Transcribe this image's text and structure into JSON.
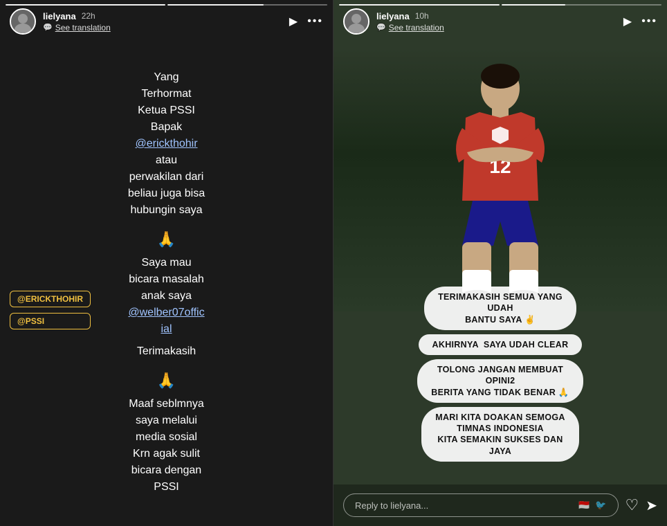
{
  "left_panel": {
    "username": "lielyana",
    "time_ago": "22h",
    "see_translation": "See translation",
    "play_label": "▶",
    "more_label": "•••",
    "content": {
      "paragraph1": "Yang\nTerhormat\nKetua PSSI\nBapak\n@erickthohir\natau\nperwakilan dari\nbeliau juga bisa\nhubungin saya",
      "prayer1": "🙏",
      "paragraph2": "Saya mau\nbicara masalah\nanak saya\n@welber07offic\nial",
      "paragraph3": "Terimakasih",
      "prayer2": "🙏",
      "paragraph4": "Maaf seblmnya\nsaya melalui\nmedia sosial\nKrn agak sulit\nbicara dengan\nPSSI",
      "tag1": "@ERICKTHOHIR",
      "tag2": "@PSSI"
    }
  },
  "right_panel": {
    "username": "lielyana",
    "time_ago": "10h",
    "see_translation": "See translation",
    "play_label": "▶",
    "more_label": "•••",
    "jersey_number": "12",
    "pills": [
      "TERIMAKASIH SEMUA YANG\nUDAH\nBANTU SAYA ✌",
      "AKHIRNYA  SAYA UDAH CLEAR",
      "TOLONG JANGAN MEMBUAT\nOPINI2\nBERITA YANG TIDAK BENAR 🙏",
      "MARI KITA DOAKAN SEMOGA\nTIMNAS INDONESIA\nKITA SEMAKIN SUKSES DAN\nJAYA"
    ],
    "reply_placeholder": "Reply to lielyana...",
    "reply_flag": "🇮🇩"
  }
}
